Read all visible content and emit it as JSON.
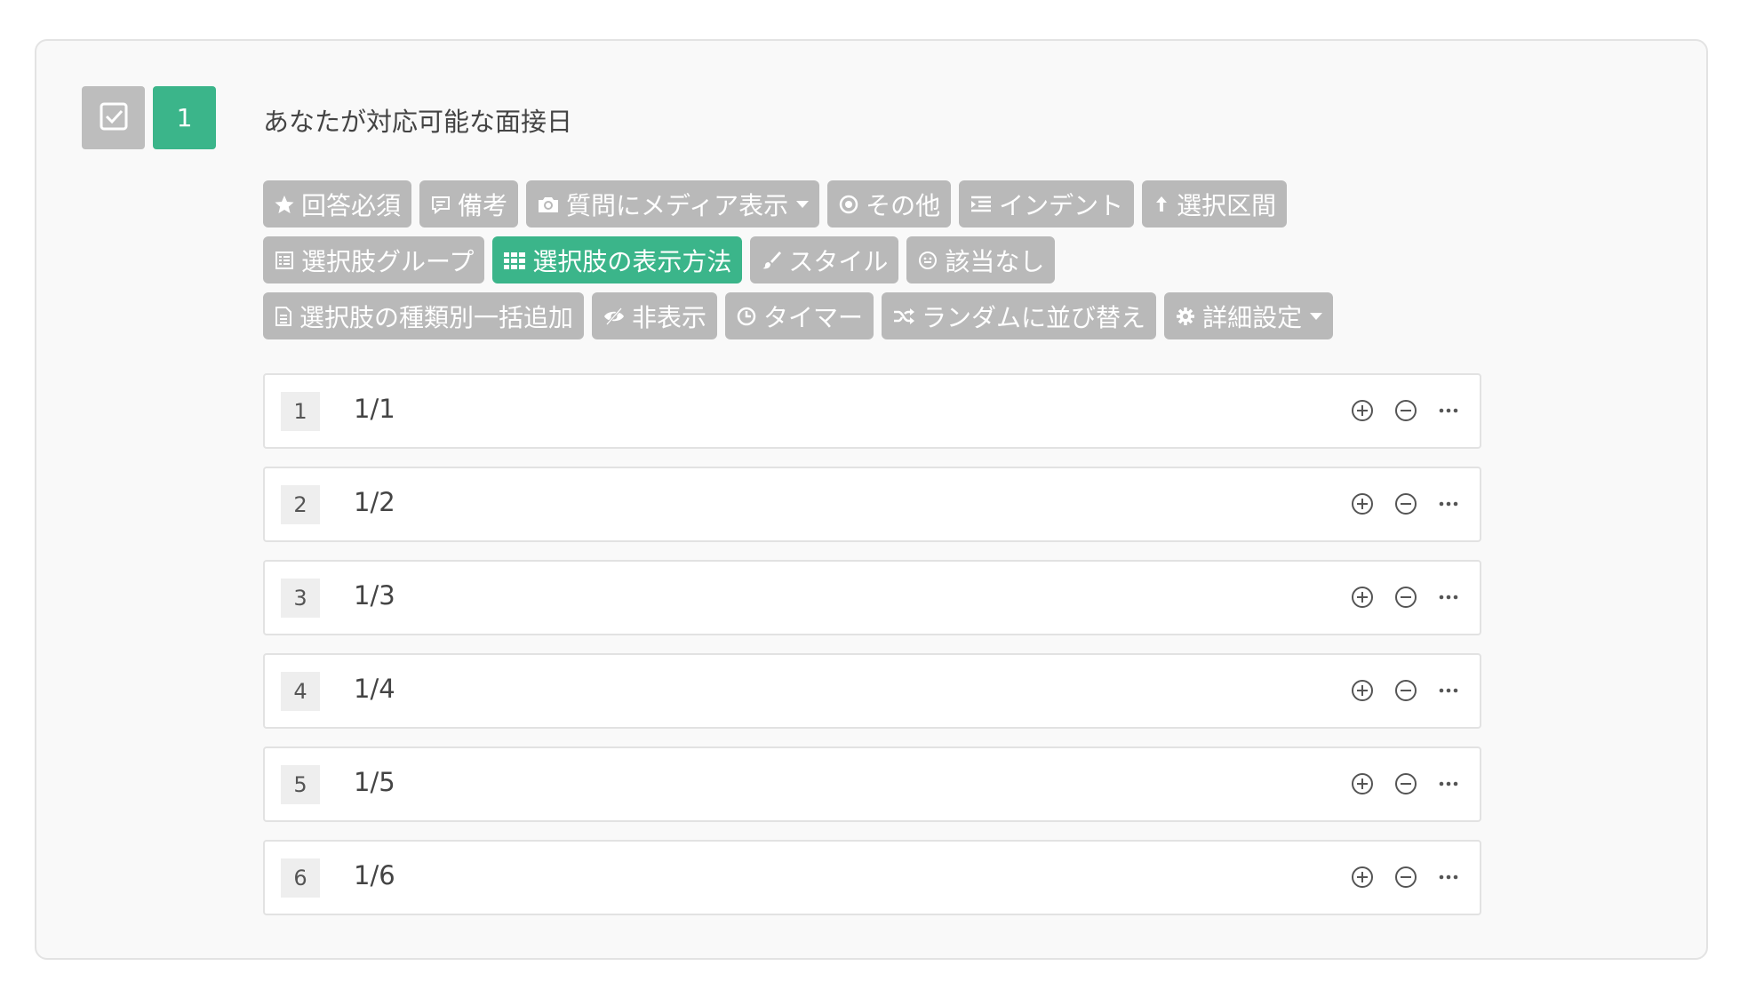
{
  "question": {
    "number": "1",
    "title": "あなたが対応可能な面接日",
    "type_icon": "checkbox-icon"
  },
  "toolbar": {
    "rows": [
      [
        {
          "label": "回答必須",
          "icon": "star-icon",
          "active": false
        },
        {
          "label": "備考",
          "icon": "comment-icon",
          "active": false
        },
        {
          "label": "質問にメディア表示",
          "icon": "camera-icon",
          "active": false,
          "dropdown": true
        },
        {
          "label": "その他",
          "icon": "radio-icon",
          "active": false
        },
        {
          "label": "インデント",
          "icon": "indent-icon",
          "active": false
        },
        {
          "label": "選択区間",
          "icon": "range-icon",
          "active": false
        }
      ],
      [
        {
          "label": "選択肢グループ",
          "icon": "list-icon",
          "active": false
        },
        {
          "label": "選択肢の表示方法",
          "icon": "grid-icon",
          "active": true
        },
        {
          "label": "スタイル",
          "icon": "brush-icon",
          "active": false
        },
        {
          "label": "該当なし",
          "icon": "smiley-icon",
          "active": false
        }
      ],
      [
        {
          "label": "選択肢の種類別一括追加",
          "icon": "document-icon",
          "active": false
        },
        {
          "label": "非表示",
          "icon": "eye-slash-icon",
          "active": false
        },
        {
          "label": "タイマー",
          "icon": "clock-icon",
          "active": false
        },
        {
          "label": "ランダムに並び替え",
          "icon": "shuffle-icon",
          "active": false
        },
        {
          "label": "詳細設定",
          "icon": "gear-icon",
          "active": false,
          "dropdown": true
        }
      ]
    ]
  },
  "options": [
    {
      "index": "1",
      "value": "1/1"
    },
    {
      "index": "2",
      "value": "1/2"
    },
    {
      "index": "3",
      "value": "1/3"
    },
    {
      "index": "4",
      "value": "1/4"
    },
    {
      "index": "5",
      "value": "1/5"
    },
    {
      "index": "6",
      "value": "1/6"
    }
  ],
  "colors": {
    "accent": "#3bb58a",
    "button_gray": "#b9b9b9",
    "card_bg": "#f9f9f9"
  }
}
